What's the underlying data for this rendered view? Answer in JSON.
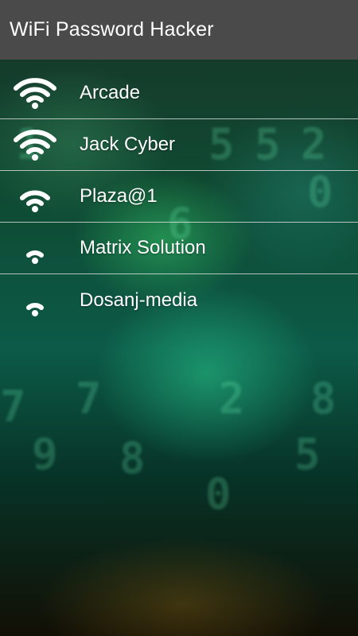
{
  "app": {
    "title": "WiFi Password Hacker"
  },
  "networks": [
    {
      "name": "Arcade",
      "signal_bars": 4,
      "icon": "wifi-signal-full-icon"
    },
    {
      "name": "Jack Cyber",
      "signal_bars": 4,
      "icon": "wifi-signal-full-icon"
    },
    {
      "name": "Plaza@1",
      "signal_bars": 3,
      "icon": "wifi-signal-medium-icon"
    },
    {
      "name": "Matrix Solution",
      "signal_bars": 2,
      "icon": "wifi-signal-low-icon"
    },
    {
      "name": "Dosanj-media",
      "signal_bars": 2,
      "icon": "wifi-signal-low-icon"
    }
  ],
  "theme": {
    "appbar_color": "#4a4a4a",
    "text_color": "#ffffff",
    "divider_color": "#ebebeb"
  }
}
